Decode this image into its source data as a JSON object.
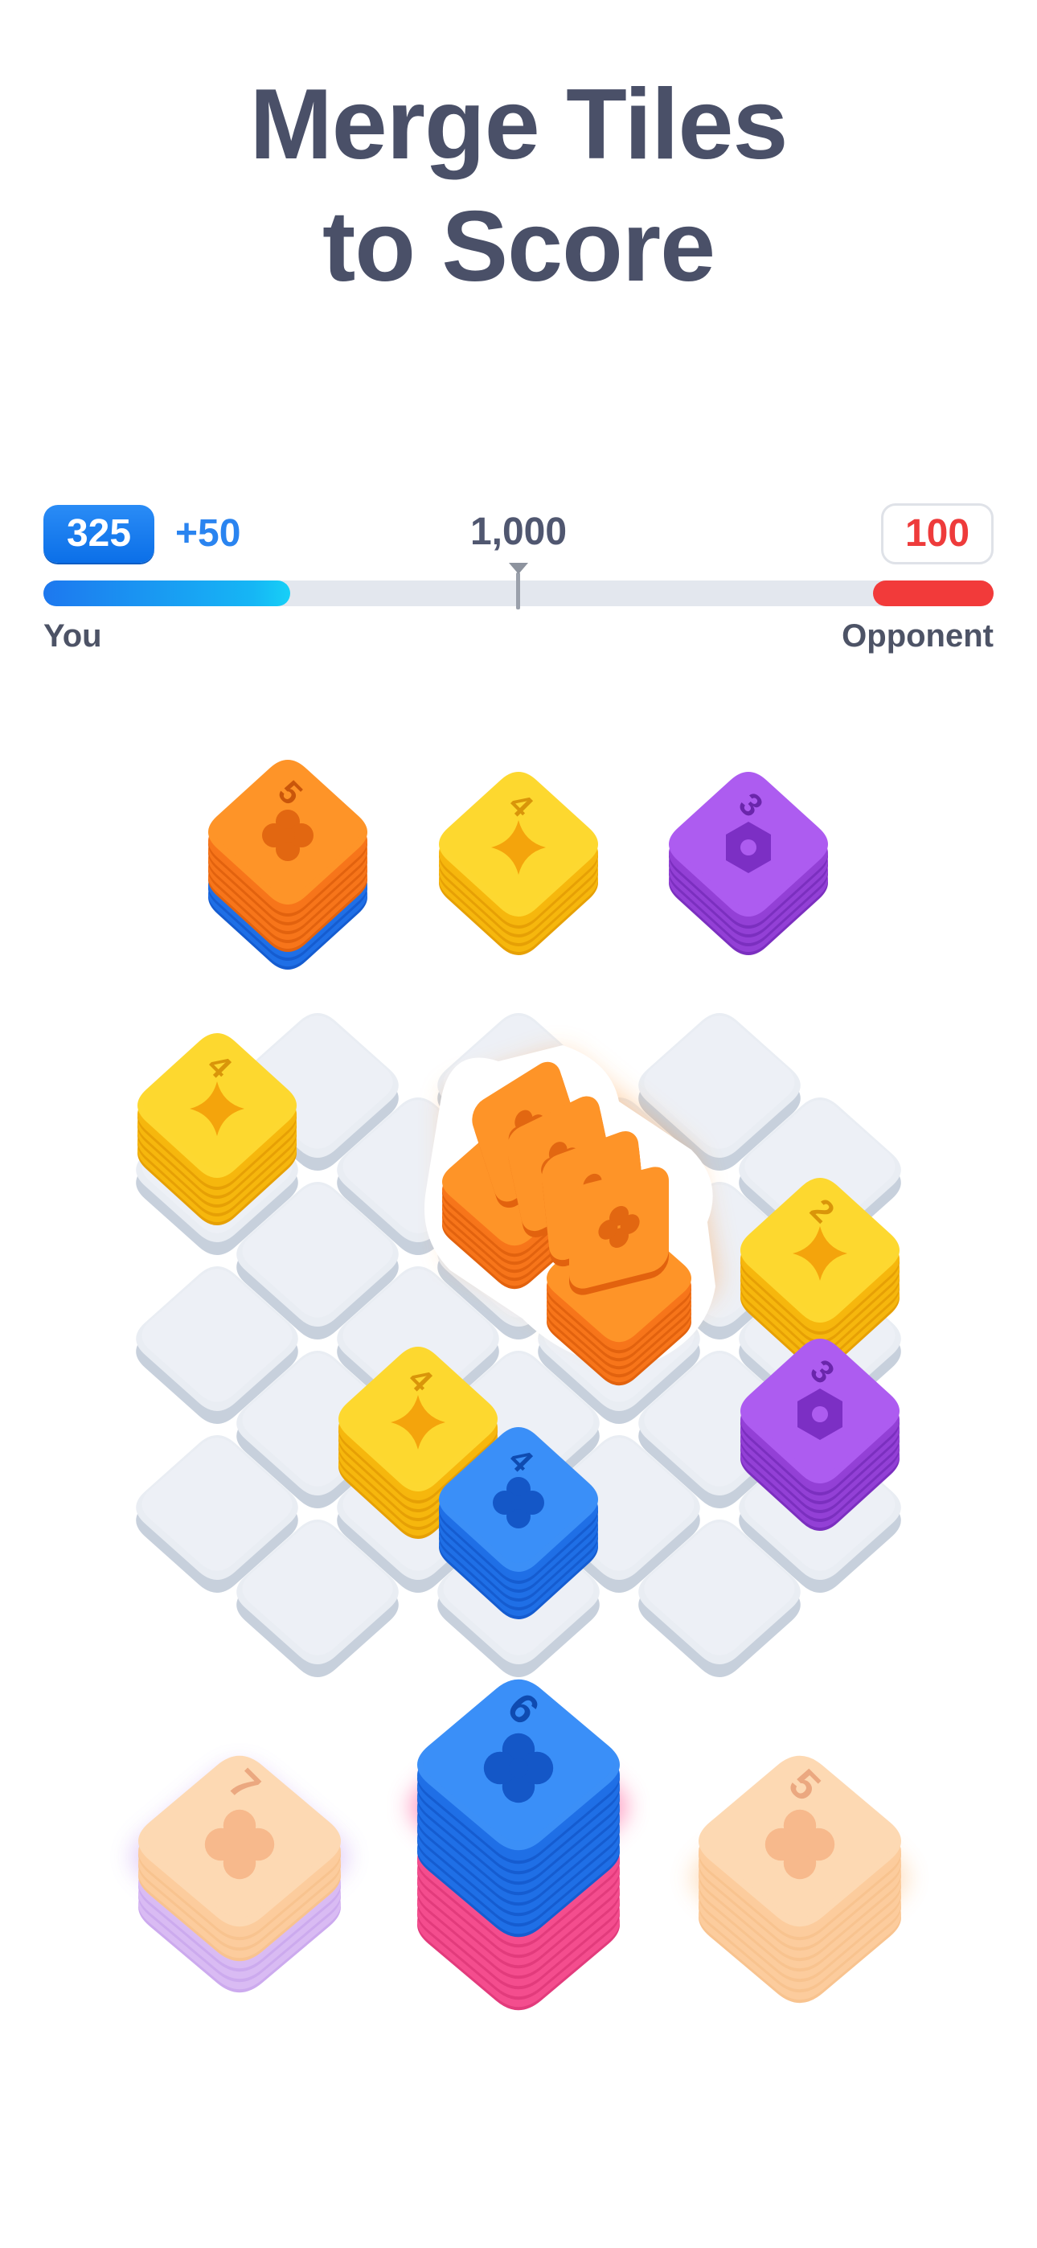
{
  "headline": {
    "line1": "Merge Tiles",
    "line2": "to Score"
  },
  "scoreboard": {
    "you_score": "325",
    "you_gain": "+50",
    "goal": "1,000",
    "opponent_score": "100",
    "you_label": "You",
    "opponent_label": "Opponent",
    "you_progress": 0.26,
    "colors": {
      "you": "#1d78ef",
      "opponent": "#f23a3a",
      "track": "#e3e7ee"
    }
  },
  "game": {
    "empty_cells": 16,
    "preview_stacks": [
      {
        "number": "5",
        "color": "orange",
        "icon": "clover-icon",
        "base": "blue"
      },
      {
        "number": "4",
        "color": "yellow",
        "icon": "star-icon"
      },
      {
        "number": "3",
        "color": "purple",
        "icon": "hexagon-icon"
      }
    ],
    "board_stacks": [
      {
        "number": "4",
        "color": "yellow",
        "icon": "star-icon"
      },
      {
        "number": "2",
        "color": "yellow",
        "icon": "star-icon"
      },
      {
        "number": "3",
        "color": "purple",
        "icon": "hexagon-icon"
      },
      {
        "number": "4",
        "color": "yellow",
        "icon": "star-icon"
      },
      {
        "number": "4",
        "color": "blue",
        "icon": "clover-icon"
      }
    ],
    "merging_stack": {
      "color": "orange",
      "icon": "clover-icon"
    },
    "hand_stacks": [
      {
        "number": "7",
        "color": "peach",
        "icon": "clover-icon",
        "faded": true
      },
      {
        "number": "6",
        "color": "blue",
        "icon": "clover-icon",
        "selected": true
      },
      {
        "number": "5",
        "color": "peach",
        "icon": "clover-icon",
        "faded": true
      }
    ],
    "palette": {
      "yellow": "#fcd21c",
      "orange": "#fd8a1e",
      "purple": "#a24be6",
      "blue": "#2f84f5",
      "peach": "#fdcc9a",
      "pink": "#fb5a9a",
      "lilac": "#d6b7f3",
      "cell": "#e9edf3"
    }
  }
}
